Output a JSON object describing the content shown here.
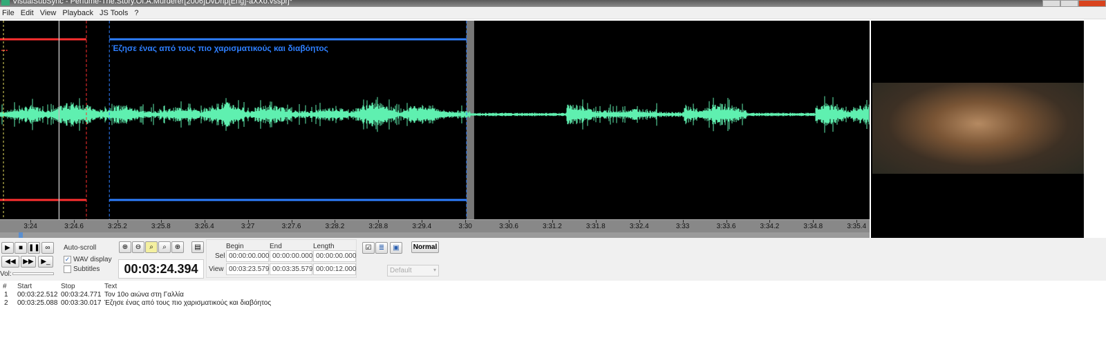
{
  "window": {
    "title": "VisualSubSync - Perfume-The.Story.Of.A.Murderer[2006]DvDrip[Eng]-aXXo.vssprj*"
  },
  "menu": [
    "File",
    "Edit",
    "View",
    "Playback",
    "JS Tools",
    "?"
  ],
  "waveform": {
    "view_start_s": 203.579,
    "view_end_s": 215.579,
    "cursor_s": 204.394,
    "subtitles": [
      {
        "start_s": 202.512,
        "stop_s": 204.771,
        "label": "Τον 10ο αιώνα στη ...",
        "color": "#ff3030"
      },
      {
        "start_s": 205.088,
        "stop_s": 210.017,
        "label": "Έζησε ένας από τους πιο χαρισματικούς και διαβόητος",
        "color": "#2e7fff"
      }
    ],
    "wave_color": "#5ff0b0",
    "ruler_labels": [
      "3:24",
      "3:24.6",
      "3:25.2",
      "3:25.8",
      "3:26.4",
      "3:27",
      "3:27.6",
      "3:28.2",
      "3:28.8",
      "3:29.4",
      "3:30",
      "3:30.6",
      "3:31.2",
      "3:31.8",
      "3:32.4",
      "3:33",
      "3:33.6",
      "3:34.2",
      "3:34.8",
      "3:35.4"
    ],
    "ruler_values_s": [
      204,
      204.6,
      205.2,
      205.8,
      206.4,
      207,
      207.6,
      208.2,
      208.8,
      209.4,
      210,
      210.6,
      211.2,
      211.8,
      212.4,
      213,
      213.6,
      214.2,
      214.8,
      215.4
    ]
  },
  "controls": {
    "auto_scroll": "Auto-scroll",
    "wav_display": "WAV display",
    "wav_checked": true,
    "subtitles": "Subtitles",
    "subtitles_checked": false,
    "vol": "Vol:",
    "timer": "00:03:24.394",
    "headers": {
      "begin": "Begin",
      "end": "End",
      "length": "Length",
      "sel": "Sel",
      "view": "View"
    },
    "sel": {
      "begin": "00:00:00.000",
      "end": "00:00:00.000",
      "length": "00:00:00.000"
    },
    "view": {
      "begin": "00:03:23.579",
      "end": "00:03:35.579",
      "length": "00:00:12.000"
    },
    "mode_button": "Normal",
    "style_select": "Default"
  },
  "list": {
    "columns": [
      "#",
      "Start",
      "Stop",
      "Text"
    ],
    "rows": [
      {
        "n": "1",
        "start": "00:03:22.512",
        "stop": "00:03:24.771",
        "text": "Τον 10ο αιώνα στη Γαλλία"
      },
      {
        "n": "2",
        "start": "00:03:25.088",
        "stop": "00:03:30.017",
        "text": "Έζησε ένας από τους πιο χαρισματικούς και διαβόητος"
      }
    ]
  }
}
